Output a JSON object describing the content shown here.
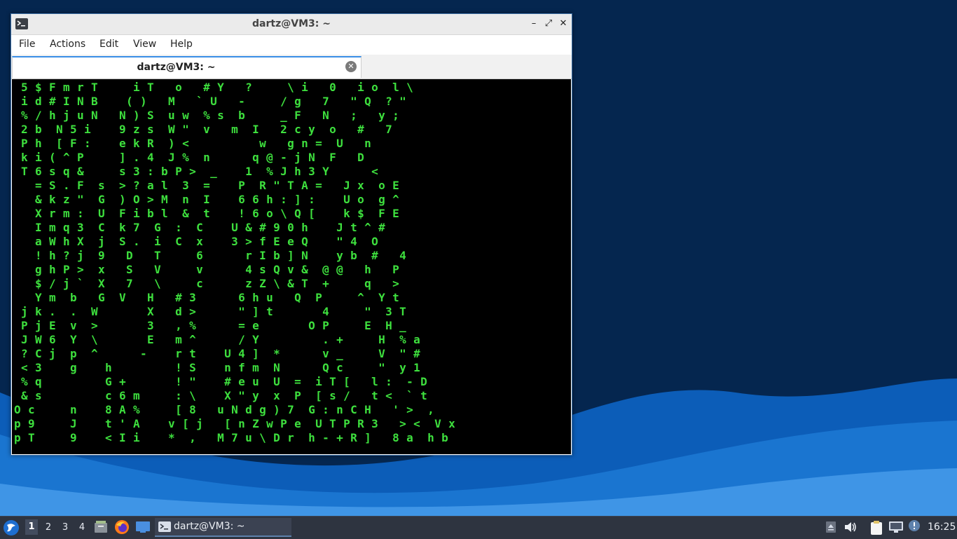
{
  "window": {
    "title": "dartz@VM3: ~",
    "controls": {
      "minimize": "–",
      "maximize": "⤢",
      "close": "✕"
    }
  },
  "menubar": {
    "items": [
      "File",
      "Actions",
      "Edit",
      "View",
      "Help"
    ]
  },
  "tab": {
    "title": "dartz@VM3: ~",
    "close": "✕"
  },
  "terminal": {
    "lines": [
      " 5 $ F m r T     i T   o   # Y   ?     \\ i   0   i o  l \\",
      " i d # I N B    ( )   M   ` U   -     / g   7   \" Q  ? \"",
      " % / h j u N   N ) S  u w  % s  b     _ F   N   ;   y ;",
      " 2 b  N 5 i    9 z s  W \"  v   m  I   2 c y  o   #   7",
      " P h  [ F :    e k R  ) <          w   g n =  U   n",
      " k i ( ^ P     ] . 4  J %  n      q @ - j N  F   D",
      " T 6 s q &     s 3 : b P >  _    1  % J h 3 Y      <",
      "   = S . F  s  > ? a l  3  =    P  R \" T A =   J x  o E",
      "   & k z \"  G  ) O > M  n  I    6 6 h : ] :    U o  g ^",
      "   X r m :  U  F i b l  &  t    ! 6 o \\ Q [    k $  F E",
      "   I m q 3  C  k 7  G  :  C    U & # 9 0 h    J t ^ #",
      "   a W h X  j  S .  i  C  x    3 > f E e Q    \" 4  O",
      "   ! h ? j  9   D   T     6      r I b ] N    y b  #   4",
      "   g h P >  x   S   V     v      4 s Q v &  @ @   h   P",
      "   $ / j `  X   7   \\     c      z Z \\ & T  +     q   >",
      "   Y m  b   G  V   H   # 3      6 h u   Q  P     ^  Y t",
      " j k .  .  W       X   d >      \" ] t       4     \"  3 T",
      " P j E  v  >       3   , %      = e       O P     E  H _",
      " J W 6  Y  \\       E   m ^      / Y         . +     H  % a",
      " ? C j  p  ^      -    r t    U 4 ]  *      v _     V  \" #",
      " < 3    g    h         ! S    n f m  N      Q c     \"  y 1",
      " % q         G +       ! \"    # e u  U  =  i T [   l :  - D",
      " & s         c 6 m     : \\    X \" y  x  P  [ s /   t <  ` t",
      "O c     n    8 A %     [ 8   u N d g ) 7  G : n C H   ' >  ,",
      "p 9     J    t ' A    v [ j   [ n Z w P e  U T P R 3   > <  V x",
      "p T     9    < I i    *  ,   M 7 u \\ D r  h - + R ]   8 a  h b"
    ]
  },
  "taskbar": {
    "desktops": [
      "1",
      "2",
      "3",
      "4"
    ],
    "active_desktop": "1",
    "launchers": [
      "file-manager-icon",
      "firefox-icon",
      "desktop-icon"
    ],
    "task_label": "dartz@VM3: ~",
    "tray_icons": [
      "eject-icon",
      "volume-icon",
      "clipboard-icon",
      "network-icon",
      "notification-icon"
    ],
    "clock": "16:25"
  },
  "colors": {
    "terminal_fg": "#3ee03e",
    "terminal_bg": "#000000",
    "desktop_dark": "#05264f",
    "desktop_wave": "#1a75d0"
  }
}
